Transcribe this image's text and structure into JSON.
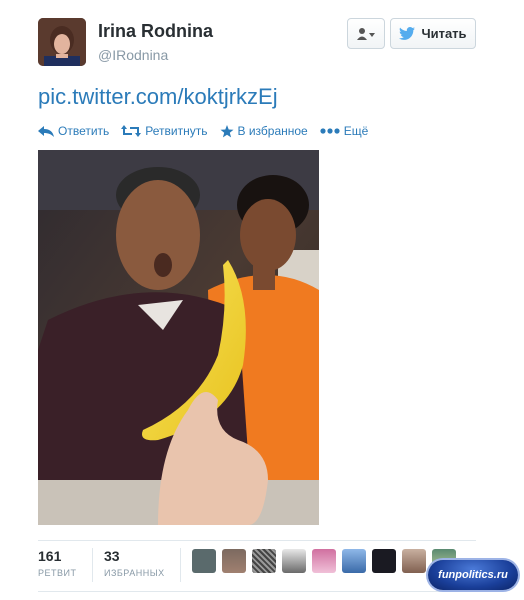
{
  "user": {
    "name": "Irina Rodnina",
    "handle": "@IRodnina"
  },
  "buttons": {
    "follow_label": "Читать"
  },
  "tweet": {
    "link_text": "pic.twitter.com/koktjrkzEj"
  },
  "actions": {
    "reply": "Ответить",
    "retweet": "Ретвитнуть",
    "favorite": "В избранное",
    "more": "Ещё"
  },
  "stats": {
    "retweets_count": "161",
    "retweets_label": "РЕТВИТ",
    "favorites_count": "33",
    "favorites_label": "ИЗБРАННЫХ"
  },
  "watermark": "funpolitics.ru",
  "colors": {
    "link": "#2b7bb9",
    "text": "#292f33",
    "muted": "#8899a6",
    "twitter_bird": "#55acee"
  }
}
